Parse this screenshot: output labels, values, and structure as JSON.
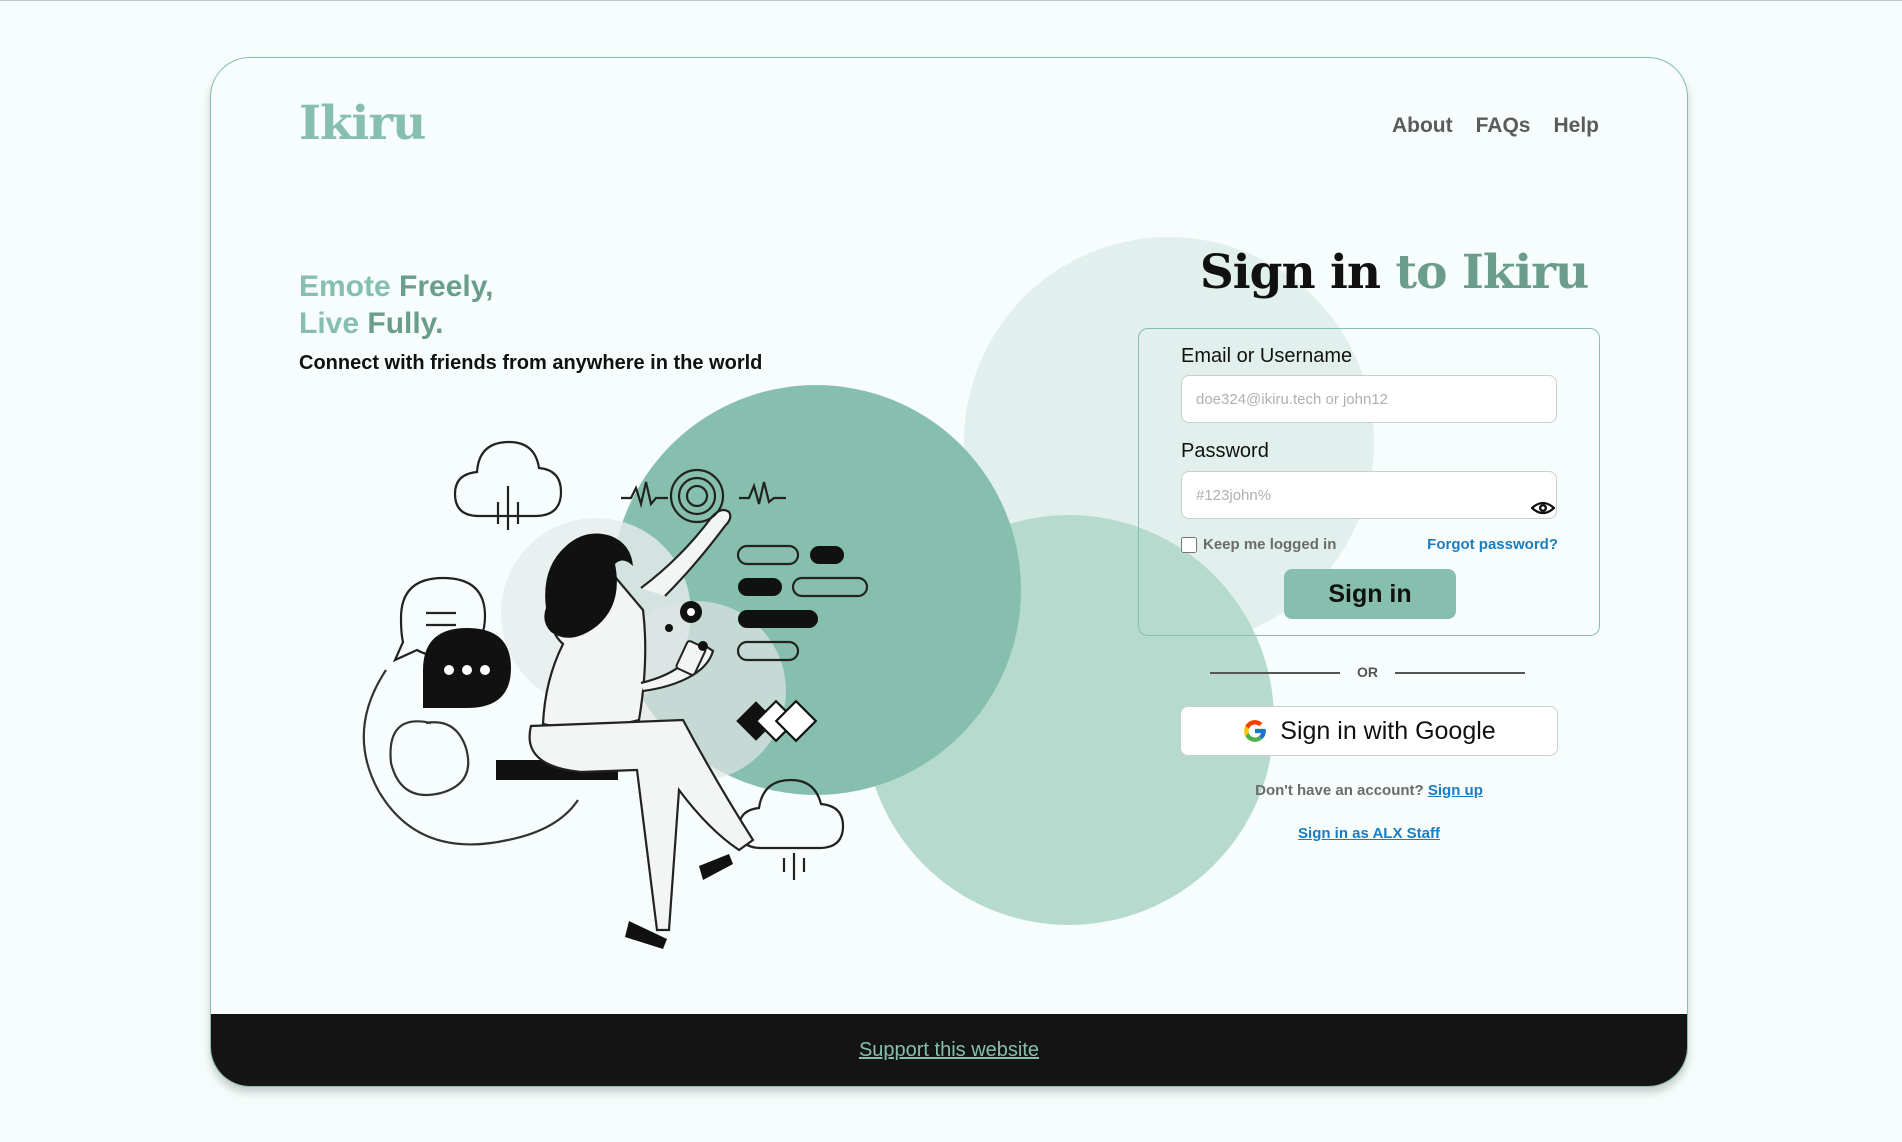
{
  "brand": {
    "logo": "Ikiru",
    "accent_color": "#86bfae",
    "accent_dark": "#6a9d8c",
    "link_color": "#1a7dc2"
  },
  "nav": {
    "items": [
      {
        "label": "About"
      },
      {
        "label": "FAQs"
      },
      {
        "label": "Help"
      }
    ]
  },
  "hero": {
    "tagline_1a": "Emote",
    "tagline_1b": " Freely,",
    "tagline_2a": "Live",
    "tagline_2b": " Fully.",
    "subtitle": "Connect with friends from anywhere in the world"
  },
  "signin": {
    "heading_1": "Sign in",
    "heading_2": " to ",
    "heading_3": "Ikiru",
    "email_label": "Email or Username",
    "email_placeholder": "doe324@ikiru.tech or john12",
    "password_label": "Password",
    "password_placeholder": "#123john%",
    "password_toggle_icon": "eye-icon",
    "remember_label": "Keep me logged in",
    "forgot_label": "Forgot password?",
    "submit_label": "Sign in",
    "divider_text": "OR",
    "google_label": "Sign in with Google",
    "google_icon": "google-g-icon",
    "no_account_text": "Don't have an account?",
    "signup_label": "Sign up",
    "staff_label": "Sign in as ALX Staff"
  },
  "footer": {
    "support_label": "Support this website"
  }
}
